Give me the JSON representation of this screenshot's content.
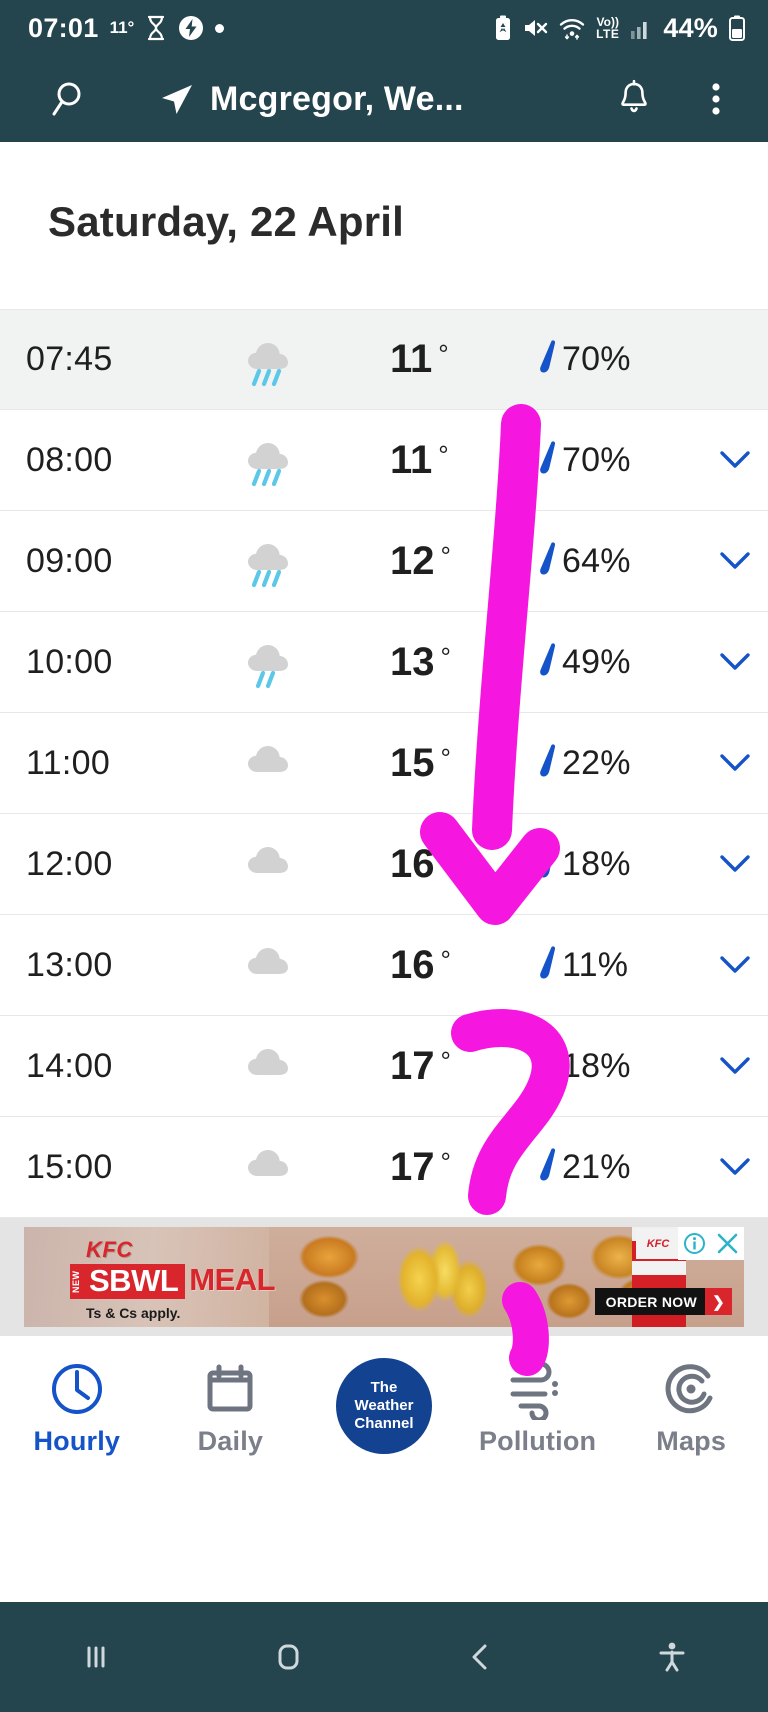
{
  "status_bar": {
    "time": "07:01",
    "temperature": "11°",
    "battery_percent": "44%",
    "network_label_top": "Vo))",
    "network_label_bottom": "LTE",
    "icons": [
      "hourglass-icon",
      "battery-saver-icon",
      "status-dot-icon",
      "recycle-battery-icon",
      "mute-icon",
      "wifi-icon",
      "volte-icon",
      "signal-bars-icon",
      "battery-icon"
    ]
  },
  "app_bar": {
    "title": "Mcgregor, We...",
    "search_icon": "search-icon",
    "location_icon": "navigation-arrow-icon",
    "alerts_icon": "bell-icon",
    "overflow_icon": "more-vertical-icon"
  },
  "main": {
    "date_heading": "Saturday, 22 April",
    "columns": [
      "time",
      "condition",
      "temperature",
      "precipitation"
    ],
    "hours": [
      {
        "time": "07:45",
        "icon": "rain-cloud-icon",
        "temp": "11",
        "degree": "°",
        "pop": "70%",
        "current": true,
        "chevron": false
      },
      {
        "time": "08:00",
        "icon": "rain-cloud-icon",
        "temp": "11",
        "degree": "°",
        "pop": "70%",
        "current": false,
        "chevron": true
      },
      {
        "time": "09:00",
        "icon": "rain-cloud-icon",
        "temp": "12",
        "degree": "°",
        "pop": "64%",
        "current": false,
        "chevron": true
      },
      {
        "time": "10:00",
        "icon": "light-rain-cloud-icon",
        "temp": "13",
        "degree": "°",
        "pop": "49%",
        "current": false,
        "chevron": true
      },
      {
        "time": "11:00",
        "icon": "cloud-icon",
        "temp": "15",
        "degree": "°",
        "pop": "22%",
        "current": false,
        "chevron": true
      },
      {
        "time": "12:00",
        "icon": "cloud-icon",
        "temp": "16",
        "degree": "°",
        "pop": "18%",
        "current": false,
        "chevron": true
      },
      {
        "time": "13:00",
        "icon": "cloud-icon",
        "temp": "16",
        "degree": "°",
        "pop": "11%",
        "current": false,
        "chevron": true
      },
      {
        "time": "14:00",
        "icon": "cloud-icon",
        "temp": "17",
        "degree": "°",
        "pop": "18%",
        "current": false,
        "chevron": true
      },
      {
        "time": "15:00",
        "icon": "cloud-icon",
        "temp": "17",
        "degree": "°",
        "pop": "21%",
        "current": false,
        "chevron": true
      }
    ]
  },
  "ad": {
    "brand": "KFC",
    "badge": "NEW",
    "headline_highlight": "SBWL",
    "headline_rest": "MEAL",
    "disclaimer": "Ts & Cs apply.",
    "cta": "ORDER NOW",
    "info_icon": "ad-info-icon",
    "close_icon": "ad-close-icon"
  },
  "bottom_nav": {
    "items": [
      {
        "label": "Hourly",
        "icon": "clock-icon",
        "active": true
      },
      {
        "label": "Daily",
        "icon": "calendar-icon",
        "active": false
      },
      {
        "label": "",
        "icon": "weather-channel-logo",
        "active": false
      },
      {
        "label": "Pollution",
        "icon": "wind-icon",
        "active": false
      },
      {
        "label": "Maps",
        "icon": "radar-icon",
        "active": false
      }
    ],
    "logo_lines": [
      "The",
      "Weather",
      "Channel"
    ]
  },
  "android_nav": {
    "items": [
      {
        "name": "recents-button",
        "icon": "recents-icon"
      },
      {
        "name": "home-button",
        "icon": "home-icon"
      },
      {
        "name": "back-button",
        "icon": "back-chevron-icon"
      },
      {
        "name": "accessibility-button",
        "icon": "accessibility-icon"
      }
    ]
  },
  "annotation": {
    "color": "#f516e0",
    "marks": [
      "down-arrow",
      "question-mark"
    ]
  },
  "colors": {
    "chrome": "#24444e",
    "accent_blue": "#1553c8",
    "twc_blue": "#134291",
    "ad_red": "#d8262c",
    "row_highlight": "#f1f2f2"
  }
}
